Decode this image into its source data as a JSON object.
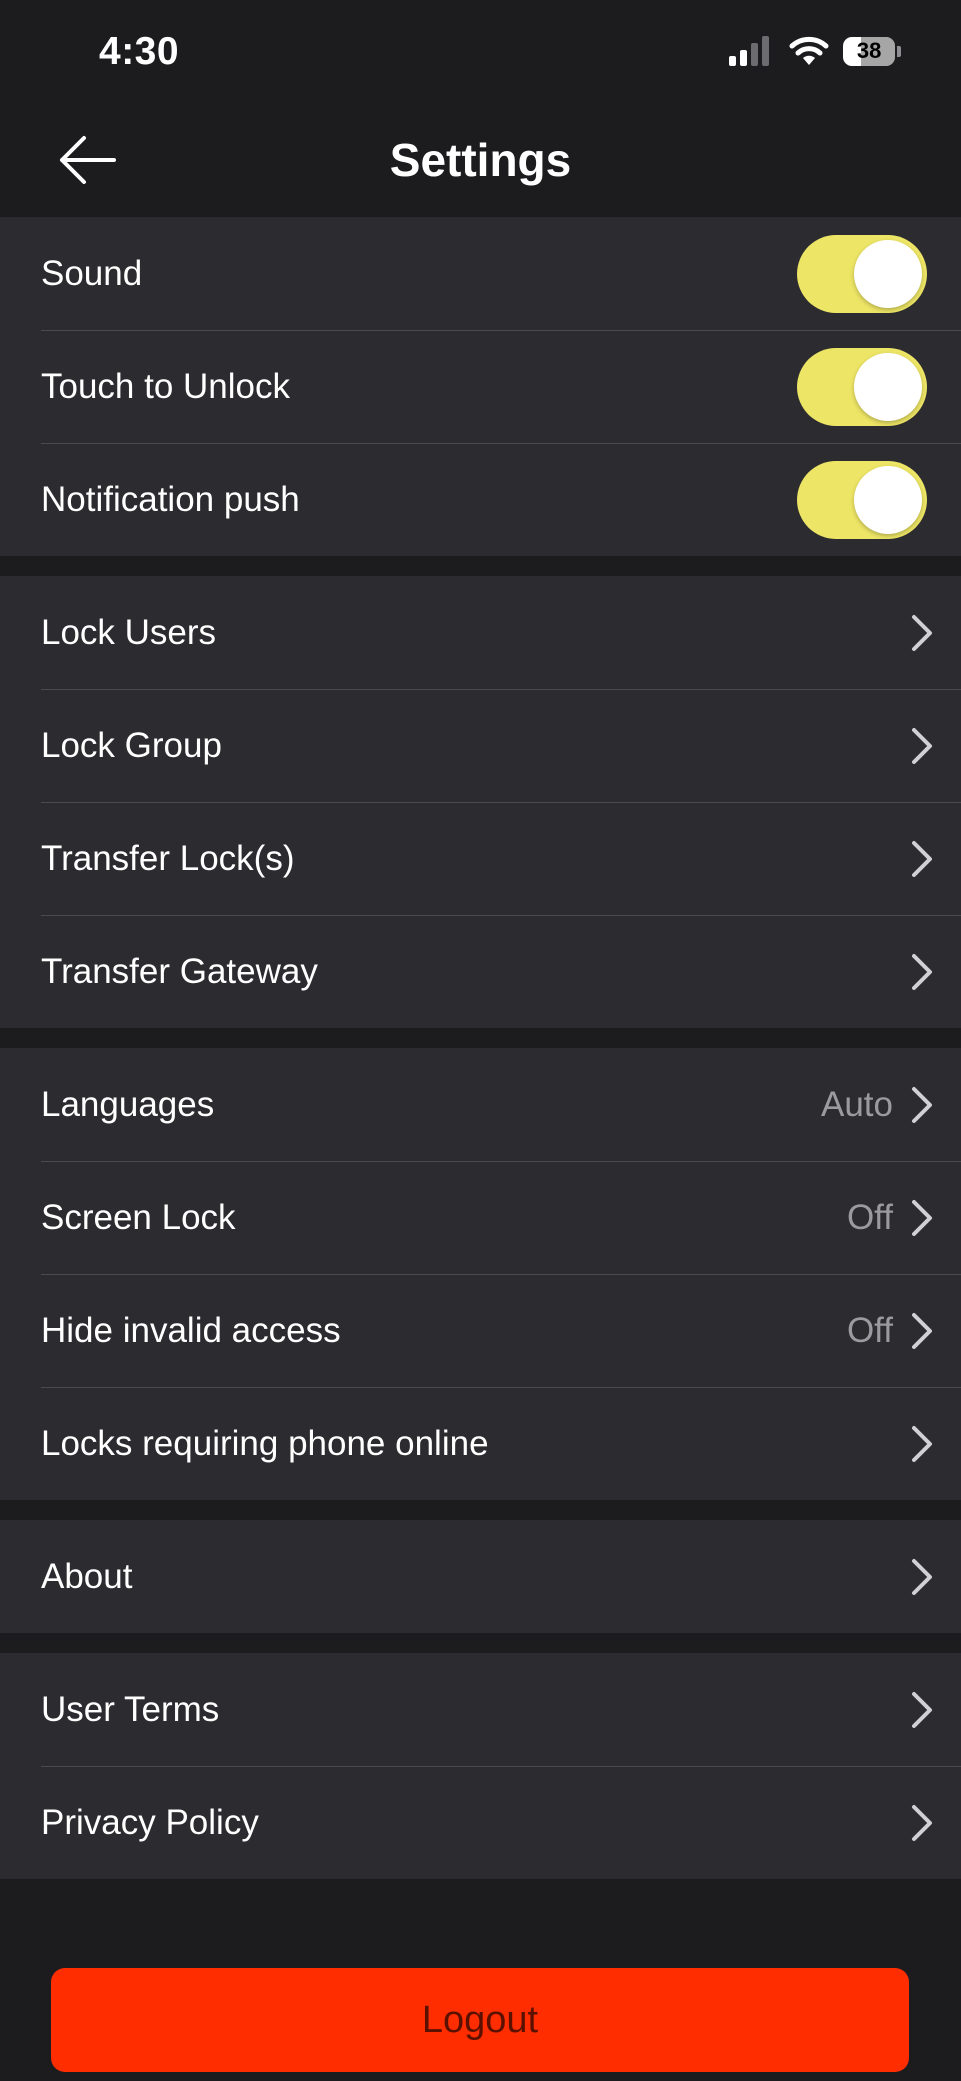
{
  "status_bar": {
    "time": "4:30",
    "battery": "38"
  },
  "header": {
    "title": "Settings",
    "back_icon": "arrow-left-icon"
  },
  "colors": {
    "toggle_on": "#ede565",
    "logout": "#ff2d00",
    "row_bg": "#2c2c30",
    "page_bg": "#1c1c1e"
  },
  "toggles": [
    {
      "label": "Sound",
      "on": true
    },
    {
      "label": "Touch to Unlock",
      "on": true
    },
    {
      "label": "Notification push",
      "on": true
    }
  ],
  "lock_settings": [
    {
      "label": "Lock Users"
    },
    {
      "label": "Lock Group"
    },
    {
      "label": "Transfer Lock(s)"
    },
    {
      "label": "Transfer Gateway"
    }
  ],
  "preferences": [
    {
      "label": "Languages",
      "value": "Auto"
    },
    {
      "label": "Screen Lock",
      "value": "Off"
    },
    {
      "label": "Hide invalid access",
      "value": "Off"
    },
    {
      "label": "Locks requiring phone online"
    }
  ],
  "about": [
    {
      "label": "About"
    }
  ],
  "legal": [
    {
      "label": "User Terms"
    },
    {
      "label": "Privacy Policy"
    }
  ],
  "logout_label": "Logout"
}
